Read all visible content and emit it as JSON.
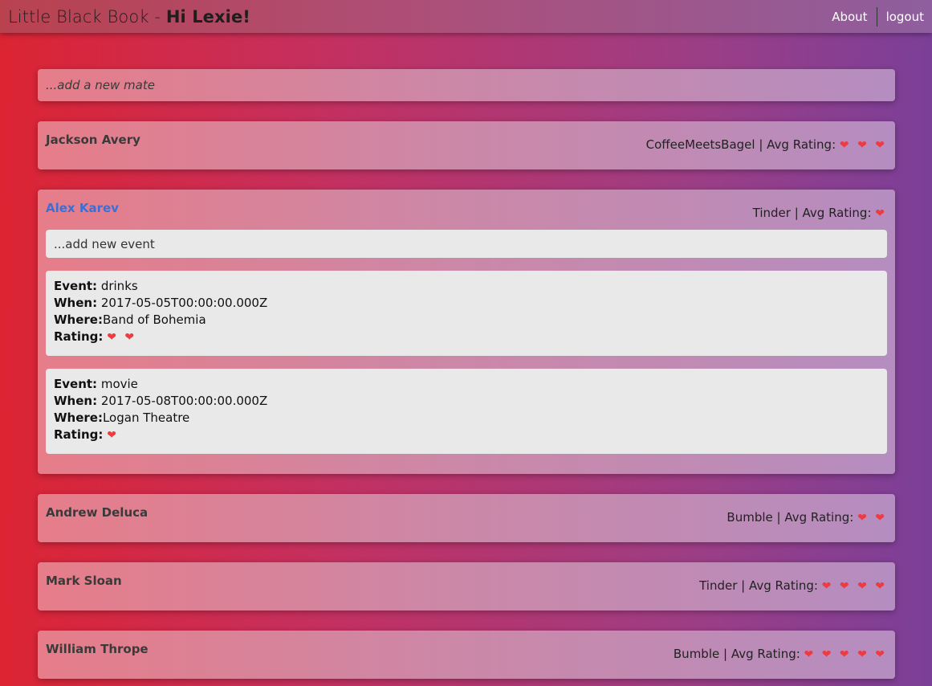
{
  "header": {
    "app_title": "Little Black Book - ",
    "greeting": "Hi Lexie!",
    "nav": {
      "about": "About",
      "logout": "logout"
    }
  },
  "add_mate_placeholder": "...add a new mate",
  "rating_prefix": "Avg Rating: ",
  "heart_icon": "heart-icon",
  "colors": {
    "heart": "#ee3b42",
    "active_name": "#3b6fd6"
  },
  "mates": [
    {
      "name": "Jackson Avery",
      "app": "CoffeeMeetsBagel",
      "avg_rating": 3,
      "hearts": "❤ ❤ ❤"
    },
    {
      "name": "Alex Karev",
      "app": "Tinder",
      "avg_rating": 1,
      "hearts": "❤",
      "expanded": true,
      "add_event_placeholder": "...add new event",
      "events": [
        {
          "event": "drinks",
          "when": "2017-05-05T00:00:00.000Z",
          "where": "Band of Bohemia",
          "rating": 2,
          "hearts": "❤ ❤"
        },
        {
          "event": "movie",
          "when": "2017-05-08T00:00:00.000Z",
          "where": "Logan Theatre",
          "rating": 1,
          "hearts": "❤"
        }
      ]
    },
    {
      "name": "Andrew Deluca",
      "app": "Bumble",
      "avg_rating": 2,
      "hearts": "❤ ❤"
    },
    {
      "name": "Mark Sloan",
      "app": "Tinder",
      "avg_rating": 4,
      "hearts": "❤ ❤ ❤ ❤"
    },
    {
      "name": "William Thrope",
      "app": "Bumble",
      "avg_rating": 5,
      "hearts": "❤ ❤ ❤ ❤ ❤"
    }
  ],
  "labels": {
    "event": "Event:",
    "when": "When:",
    "where": "Where:",
    "rating": "Rating:"
  }
}
